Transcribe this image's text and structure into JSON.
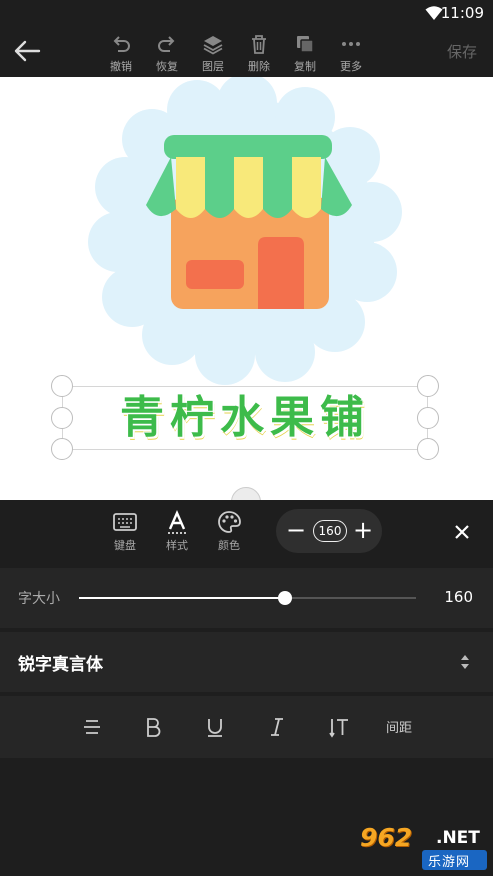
{
  "status_bar": {
    "time": "11:09"
  },
  "toolbar": {
    "undo_label": "撤销",
    "redo_label": "恢复",
    "layers_label": "图层",
    "delete_label": "删除",
    "copy_label": "复制",
    "more_label": "更多",
    "save_label": "保存"
  },
  "canvas": {
    "title_text": "青柠水果铺",
    "colors": {
      "awning_green": "#5ccf8a",
      "awning_yellow": "#f8e97a",
      "shop_orange": "#f6a35d",
      "door_red": "#f3704d",
      "cloud_blue": "#dff2fb",
      "text_green": "#3dbb4a"
    }
  },
  "panel": {
    "tabs": [
      {
        "label": "键盘"
      },
      {
        "label": "样式"
      },
      {
        "label": "颜色"
      }
    ],
    "stepper_value": "160",
    "size_label": "字大小",
    "size_value": "160",
    "size_fraction": 0.61,
    "font_name": "锐字真言体",
    "spacing_label": "间距"
  },
  "watermark": {
    "number": "962",
    "suffix": ".NET",
    "sub": "乐游网"
  }
}
